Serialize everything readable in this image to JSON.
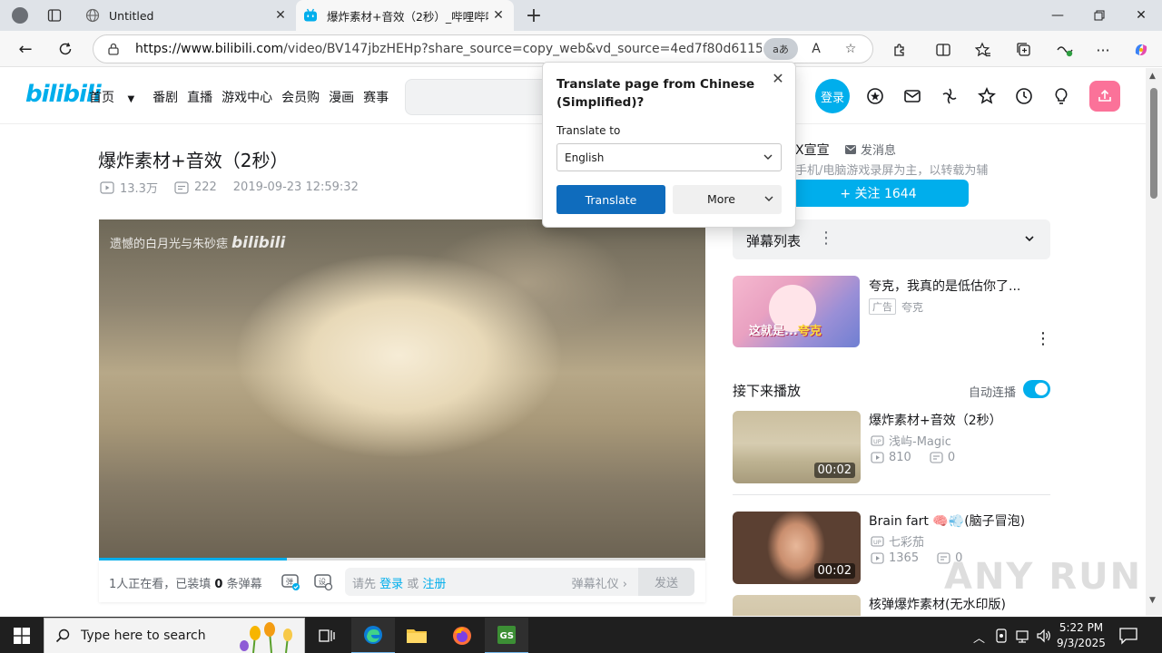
{
  "browser": {
    "tabs": [
      {
        "label": "Untitled",
        "active": false
      },
      {
        "label": "爆炸素材+音效（2秒）_哔哩哔哩",
        "active": true
      }
    ],
    "url_host": "https://www.bilibili.com",
    "url_path": "/video/BV147jbzHEHp?share_source=copy_web&vd_source=4ed7f80d61155b7c7eee...",
    "translate_chip": "aあ",
    "read_aloud": "A"
  },
  "site_header": {
    "logo": "bilibili",
    "nav": [
      "首页",
      "番剧",
      "直播",
      "游戏中心",
      "会员购",
      "漫画",
      "赛事"
    ],
    "login_label": "登录"
  },
  "video": {
    "title": "爆炸素材+音效（2秒）",
    "views": "13.3万",
    "danmaku_count": "222",
    "date": "2019-09-23 12:59:32",
    "watermark_text": "遗憾的白月光与朱砂痣",
    "watermark_logo": "bilibili",
    "progress": 0.31
  },
  "danmaku_bar": {
    "watching_prefix": "1人正在看，已装填 ",
    "watching_count": "0",
    "watching_suffix": " 条弹幕",
    "prompt_prefix": "请先 ",
    "login_link": "登录",
    "or": " 或 ",
    "register_link": "注册",
    "etiquette": "弹幕礼仪 ›",
    "send": "发送"
  },
  "uploader": {
    "name_fragment": "X宣宣",
    "message": "发消息",
    "desc_fragment": "手机/电脑游戏录屏为主，以转载为辅",
    "follow": "+ 关注 1644"
  },
  "danmaku_list": {
    "title": "弹幕列表"
  },
  "ad": {
    "title": "夸克，我真的是低估你了...",
    "badge": "广告",
    "author": "夸克",
    "thumb_caption_a": "这就是...",
    "thumb_caption_b": "夸克"
  },
  "up_next": {
    "title": "接下来播放",
    "autoplay": "自动连播",
    "autoplay_on": true
  },
  "recommendations": [
    {
      "title": "爆炸素材+音效（2秒）",
      "author": "浅屿-Magic",
      "views": "810",
      "danmaku": "0",
      "duration": "00:02"
    },
    {
      "title": "Brain fart 🧠💨(脑子冒泡)",
      "author": "七彩茄",
      "views": "1365",
      "danmaku": "0",
      "duration": "00:02"
    },
    {
      "title": "核弹爆炸素材(无水印版)",
      "author": "",
      "views": "",
      "danmaku": "",
      "duration": ""
    }
  ],
  "translate_popup": {
    "title": "Translate page from Chinese (Simplified)?",
    "to_label": "Translate to",
    "language": "English",
    "translate_button": "Translate",
    "more_button": "More"
  },
  "taskbar": {
    "search_placeholder": "Type here to search",
    "time": "5:22 PM",
    "date": "9/3/2025"
  },
  "overlay_watermark": "ANY RUN",
  "colors": {
    "bili_blue": "#00aeec",
    "bili_pink": "#fb7299",
    "edge_blue": "#0f6cbd"
  }
}
